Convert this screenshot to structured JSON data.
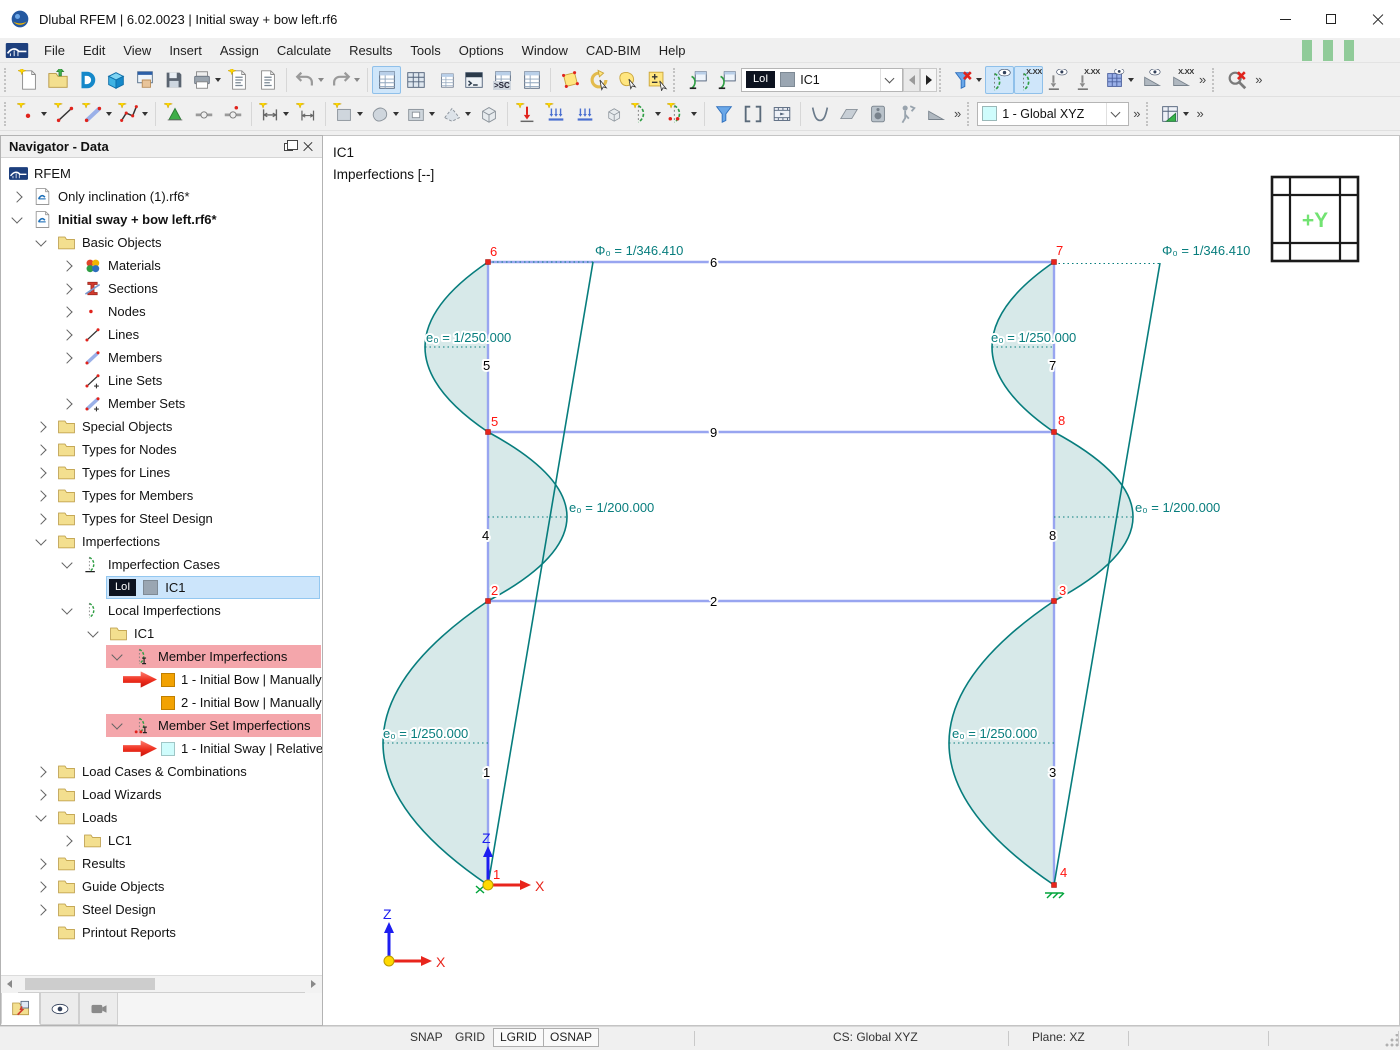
{
  "window": {
    "title": "Dlubal RFEM | 6.02.0023 | Initial sway + bow left.rf6"
  },
  "menu": [
    "File",
    "Edit",
    "View",
    "Insert",
    "Assign",
    "Calculate",
    "Results",
    "Tools",
    "Options",
    "Window",
    "CAD-BIM",
    "Help"
  ],
  "toolbar": {
    "imperfection_case_badge": "LoI",
    "imperfection_case_name": "IC1",
    "coordinate_system": "1 - Global XYZ",
    "sc_label": ">SC",
    "values_label": "X.XX",
    "more_label": "»"
  },
  "navigator": {
    "title": "Navigator - Data",
    "case_badge": "LoI",
    "items": [
      "RFEM",
      "Only inclination (1).rf6*",
      "Initial sway + bow left.rf6*",
      "Basic Objects",
      "Materials",
      "Sections",
      "Nodes",
      "Lines",
      "Members",
      "Line Sets",
      "Member Sets",
      "Special Objects",
      "Types for Nodes",
      "Types for Lines",
      "Types for Members",
      "Types for Steel Design",
      "Imperfections",
      "Imperfection Cases",
      "IC1",
      "Local Imperfections",
      "IC1",
      "Member Imperfections",
      "1 - Initial Bow | Manually",
      "2 - Initial Bow | Manually",
      "Member Set Imperfections",
      "1 - Initial Sway | Relative",
      "Load Cases & Combinations",
      "Load Wizards",
      "Loads",
      "LC1",
      "Results",
      "Guide Objects",
      "Steel Design",
      "Printout Reports"
    ]
  },
  "canvas": {
    "title": "IC1",
    "subtitle": "Imperfections [--]",
    "viewcube": "+Y",
    "phi0_left": "Φ₀ =  1/346.410",
    "phi0_right": "Φ₀ =  1/346.410",
    "e0": {
      "l_top": "e₀ =  1/250.000",
      "l_mid": "e₀ =  1/200.000",
      "l_bot": "e₀ =  1/250.000",
      "r_top": "e₀ =  1/250.000",
      "r_mid": "e₀ =  1/200.000",
      "r_bot": "e₀ =  1/250.000"
    },
    "nodes": {
      "n1": "1",
      "n2": "2",
      "n3": "3",
      "n4": "4",
      "n5": "5",
      "n6": "6",
      "n7": "7",
      "n8": "8"
    },
    "members": {
      "m1": "1",
      "m2": "2",
      "m3": "3",
      "m4": "4",
      "m5": "5",
      "m6": "6",
      "m7": "7",
      "m8": "8",
      "m9": "9"
    },
    "axes": {
      "x": "X",
      "z": "Z"
    }
  },
  "statusbar": {
    "snap": "SNAP",
    "grid": "GRID",
    "lgrid": "LGRID",
    "osnap": "OSNAP",
    "cs": "CS: Global XYZ",
    "plane": "Plane: XZ"
  },
  "colors": {
    "teal": "#077d7d",
    "member_blue": "#98a5f0",
    "node_red": "#e8251c",
    "bow_fill": "#d9e7e4",
    "selection_blue": "#cce5fb",
    "highlight_pink": "#f4a6ab",
    "swatch_orange": "#f2a202",
    "swatch_cyan": "#cffcfc",
    "badge_bg": "#0d1320",
    "viewcube_green": "#72e372"
  }
}
